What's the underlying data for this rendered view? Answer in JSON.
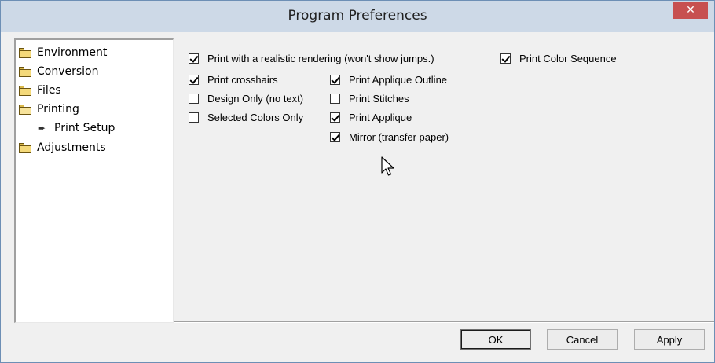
{
  "window": {
    "title": "Program Preferences",
    "close_glyph": "✕"
  },
  "tree": {
    "items": [
      {
        "label": "Environment",
        "icon": "folder-icon"
      },
      {
        "label": "Conversion",
        "icon": "folder-icon"
      },
      {
        "label": "Files",
        "icon": "folder-icon"
      },
      {
        "label": "Printing",
        "icon": "open-folder-icon"
      },
      {
        "label": "Print Setup",
        "icon": "arrow-right-icon"
      },
      {
        "label": "Adjustments",
        "icon": "folder-icon"
      }
    ]
  },
  "options": {
    "realistic": {
      "label": "Print with a realistic rendering (won't show jumps.)",
      "checked": true
    },
    "color_sequence": {
      "label": "Print Color Sequence",
      "checked": true
    },
    "crosshairs": {
      "label": "Print crosshairs",
      "checked": true
    },
    "design_only": {
      "label": "Design Only (no text)",
      "checked": false
    },
    "selected_colors": {
      "label": "Selected Colors Only",
      "checked": false
    },
    "applique_outline": {
      "label": "Print Applique Outline",
      "checked": true
    },
    "stitches": {
      "label": "Print Stitches",
      "checked": false
    },
    "applique": {
      "label": "Print Applique",
      "checked": true
    },
    "mirror": {
      "label": "Mirror (transfer paper)",
      "checked": true
    }
  },
  "buttons": {
    "ok": "OK",
    "cancel": "Cancel",
    "apply": "Apply"
  },
  "colors": {
    "titlebar": "#cdd9e7",
    "close": "#c75050",
    "panel": "#f0f0f0"
  }
}
